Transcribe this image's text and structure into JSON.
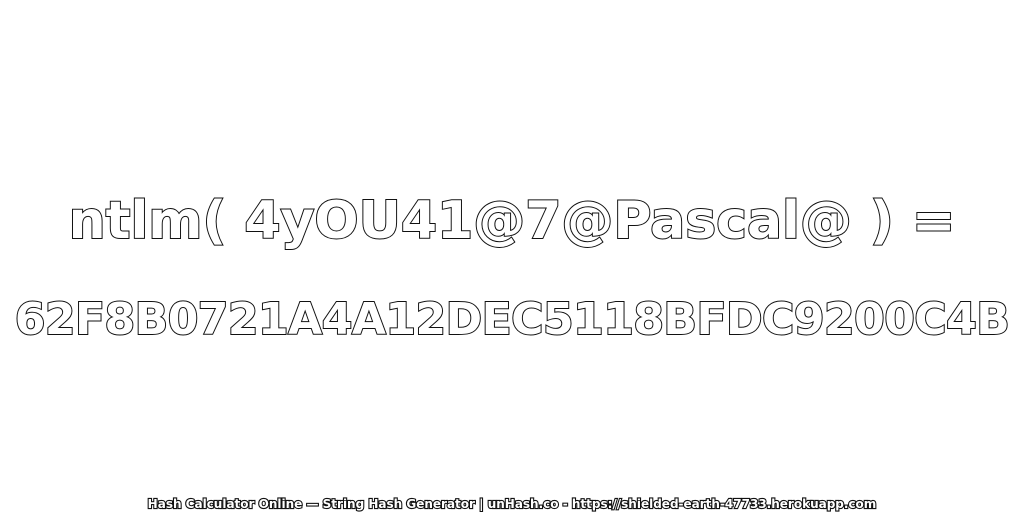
{
  "expression": "ntlm( 4yOU41@7@Pascal@ ) =",
  "hash_value": "62F8B0721A4A12DEC5118BFDC9200C4B",
  "footer_text": "Hash Calculator Online — String Hash Generator | unHash.co - https://shielded-earth-47733.herokuapp.com"
}
